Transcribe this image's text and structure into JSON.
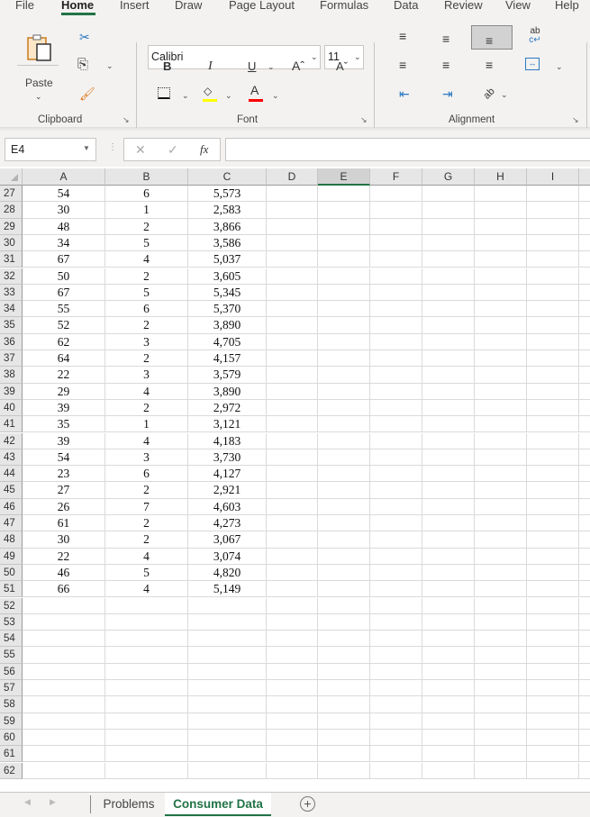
{
  "menu": {
    "tabs": [
      "File",
      "Home",
      "Insert",
      "Draw",
      "Page Layout",
      "Formulas",
      "Data",
      "Review",
      "View",
      "Help"
    ],
    "active_tab": "Home"
  },
  "ribbon": {
    "clipboard": {
      "label": "Clipboard",
      "paste_label": "Paste",
      "icons": [
        "paste-icon",
        "cut-icon",
        "copy-icon",
        "format-painter-icon"
      ]
    },
    "font": {
      "label": "Font",
      "font_name": "Calibri",
      "font_size": "11",
      "bold": "B",
      "italic": "I",
      "underline": "U",
      "grow": "Aˆ",
      "shrink": "Aˇ",
      "font_color_glyph": "A",
      "fill_color": "#ffff00",
      "font_color": "#ff0000"
    },
    "alignment": {
      "label": "Alignment",
      "wrap_glyph": "ab↵"
    }
  },
  "formula_bar": {
    "name_box": "E4",
    "fx": "fx",
    "cancel": "✕",
    "enter": "✓",
    "formula": ""
  },
  "sheet": {
    "columns": [
      "A",
      "B",
      "C",
      "D",
      "E",
      "F",
      "G",
      "H",
      "I"
    ],
    "selected_column": "E",
    "rows": [
      {
        "n": "27",
        "a": "54",
        "b": "6",
        "c": "5,573"
      },
      {
        "n": "28",
        "a": "30",
        "b": "1",
        "c": "2,583"
      },
      {
        "n": "29",
        "a": "48",
        "b": "2",
        "c": "3,866"
      },
      {
        "n": "30",
        "a": "34",
        "b": "5",
        "c": "3,586"
      },
      {
        "n": "31",
        "a": "67",
        "b": "4",
        "c": "5,037"
      },
      {
        "n": "32",
        "a": "50",
        "b": "2",
        "c": "3,605"
      },
      {
        "n": "33",
        "a": "67",
        "b": "5",
        "c": "5,345"
      },
      {
        "n": "34",
        "a": "55",
        "b": "6",
        "c": "5,370"
      },
      {
        "n": "35",
        "a": "52",
        "b": "2",
        "c": "3,890"
      },
      {
        "n": "36",
        "a": "62",
        "b": "3",
        "c": "4,705"
      },
      {
        "n": "37",
        "a": "64",
        "b": "2",
        "c": "4,157"
      },
      {
        "n": "38",
        "a": "22",
        "b": "3",
        "c": "3,579"
      },
      {
        "n": "39",
        "a": "29",
        "b": "4",
        "c": "3,890"
      },
      {
        "n": "40",
        "a": "39",
        "b": "2",
        "c": "2,972"
      },
      {
        "n": "41",
        "a": "35",
        "b": "1",
        "c": "3,121"
      },
      {
        "n": "42",
        "a": "39",
        "b": "4",
        "c": "4,183"
      },
      {
        "n": "43",
        "a": "54",
        "b": "3",
        "c": "3,730"
      },
      {
        "n": "44",
        "a": "23",
        "b": "6",
        "c": "4,127"
      },
      {
        "n": "45",
        "a": "27",
        "b": "2",
        "c": "2,921"
      },
      {
        "n": "46",
        "a": "26",
        "b": "7",
        "c": "4,603"
      },
      {
        "n": "47",
        "a": "61",
        "b": "2",
        "c": "4,273"
      },
      {
        "n": "48",
        "a": "30",
        "b": "2",
        "c": "3,067"
      },
      {
        "n": "49",
        "a": "22",
        "b": "4",
        "c": "3,074"
      },
      {
        "n": "50",
        "a": "46",
        "b": "5",
        "c": "4,820"
      },
      {
        "n": "51",
        "a": "66",
        "b": "4",
        "c": "5,149"
      },
      {
        "n": "52",
        "a": "",
        "b": "",
        "c": ""
      },
      {
        "n": "53",
        "a": "",
        "b": "",
        "c": ""
      },
      {
        "n": "54",
        "a": "",
        "b": "",
        "c": ""
      },
      {
        "n": "55",
        "a": "",
        "b": "",
        "c": ""
      },
      {
        "n": "56",
        "a": "",
        "b": "",
        "c": ""
      },
      {
        "n": "57",
        "a": "",
        "b": "",
        "c": ""
      },
      {
        "n": "58",
        "a": "",
        "b": "",
        "c": ""
      },
      {
        "n": "59",
        "a": "",
        "b": "",
        "c": ""
      },
      {
        "n": "60",
        "a": "",
        "b": "",
        "c": ""
      },
      {
        "n": "61",
        "a": "",
        "b": "",
        "c": ""
      },
      {
        "n": "62",
        "a": "",
        "b": "",
        "c": ""
      }
    ]
  },
  "sheet_tabs": {
    "tabs": [
      "Problems",
      "Consumer Data"
    ],
    "active": "Consumer Data",
    "add_glyph": "+"
  },
  "colors": {
    "accent": "#217346"
  }
}
